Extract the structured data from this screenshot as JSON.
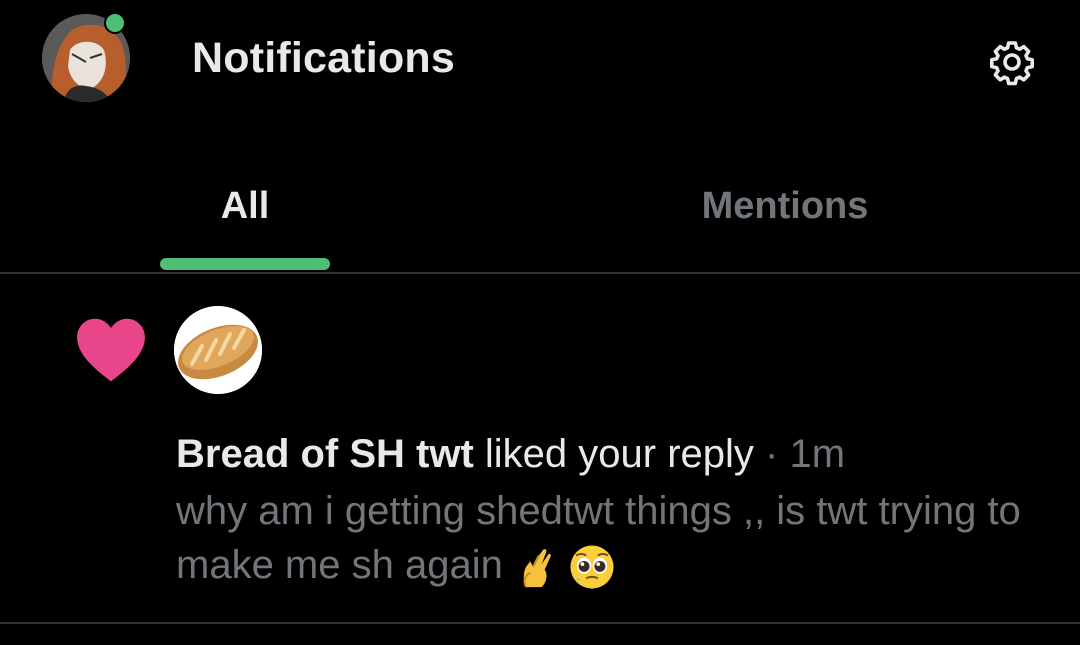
{
  "header": {
    "title": "Notifications",
    "avatar_icon": "profile-avatar",
    "settings_icon": "gear-icon",
    "status_color": "#4fbf78"
  },
  "tabs": [
    {
      "label": "All",
      "active": true
    },
    {
      "label": "Mentions",
      "active": false
    }
  ],
  "accent": "#4fbf78",
  "notification": {
    "type_icon": "heart-icon",
    "type_color": "#e8458b",
    "actor_avatar_icon": "bread-avatar",
    "actor_name": "Bread of SH twt",
    "action": " liked your reply",
    "separator": " · ",
    "time": "1m",
    "reply_text": "why am i getting shedtwt things ,, is twt trying to make me sh again",
    "emojis": [
      "crossed-fingers-emoji",
      "pleading-face-emoji"
    ]
  }
}
